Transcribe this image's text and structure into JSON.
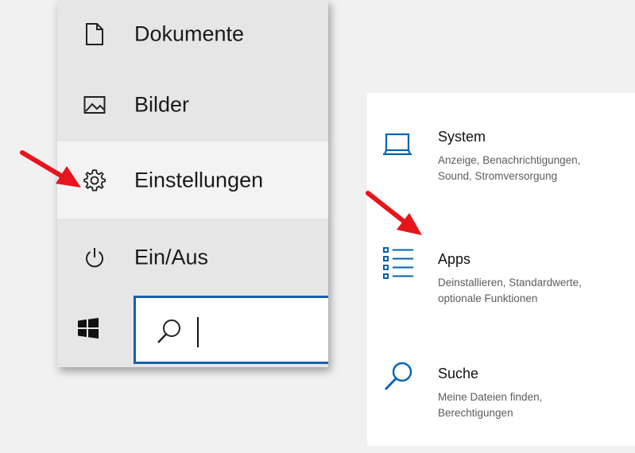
{
  "start_menu": {
    "items": [
      {
        "label": "Dokumente",
        "icon": "document-icon"
      },
      {
        "label": "Bilder",
        "icon": "picture-icon"
      },
      {
        "label": "Einstellungen",
        "icon": "gear-icon",
        "highlighted": true
      },
      {
        "label": "Ein/Aus",
        "icon": "power-icon"
      }
    ]
  },
  "taskbar": {
    "start_icon": "windows-logo-icon",
    "search": {
      "value": "",
      "icon": "search-icon"
    }
  },
  "settings": {
    "items": [
      {
        "title": "System",
        "desc1": "Anzeige, Benachrichtigungen,",
        "desc2": "Sound, Stromversorgung",
        "icon": "laptop-icon"
      },
      {
        "title": "Apps",
        "desc1": "Deinstallieren, Standardwerte,",
        "desc2": "optionale Funktionen",
        "icon": "apps-list-icon"
      },
      {
        "title": "Suche",
        "desc1": "Meine Dateien finden,",
        "desc2": "Berechtigungen",
        "icon": "search-icon"
      }
    ]
  },
  "colors": {
    "accent": "#1a5fa8",
    "settings_icon": "#0063b1",
    "annotation_arrow": "#e8141b",
    "menu_background": "#e6e6e6",
    "menu_highlight": "#f3f3f3"
  }
}
